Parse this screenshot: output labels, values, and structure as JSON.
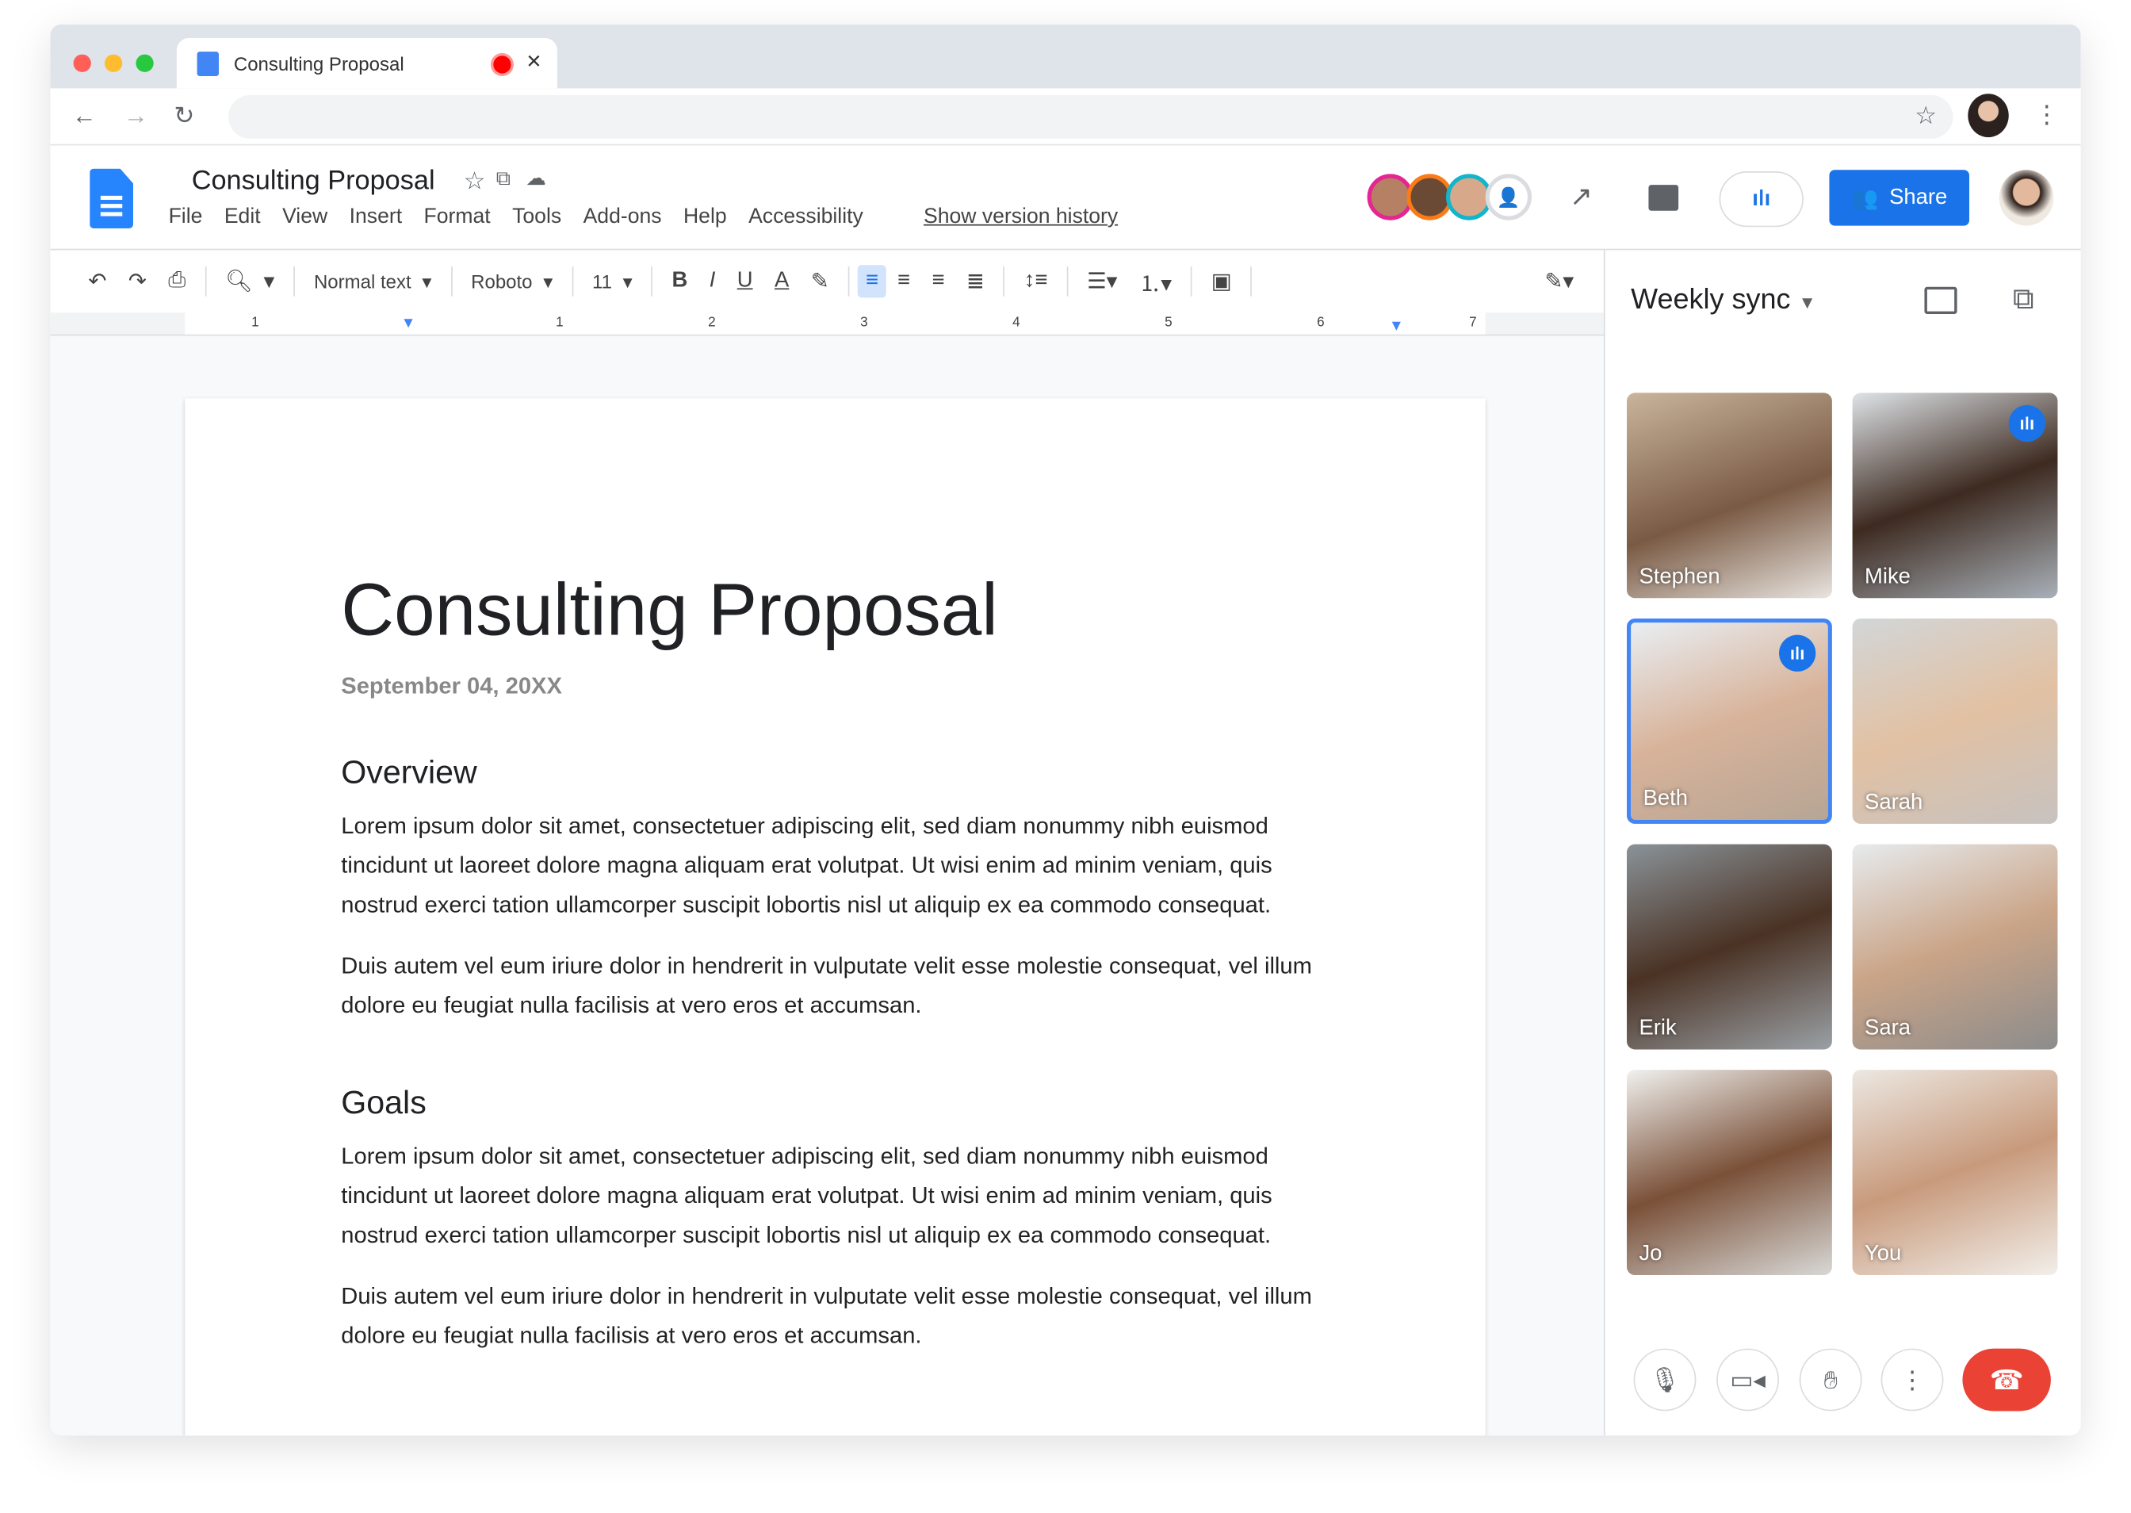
{
  "browser": {
    "tab_title": "Consulting Proposal",
    "close": "✕"
  },
  "docs": {
    "title": "Consulting Proposal",
    "menu": [
      "File",
      "Edit",
      "View",
      "Insert",
      "Format",
      "Tools",
      "Add-ons",
      "Help",
      "Accessibility"
    ],
    "version_history": "Show version history",
    "share": "Share"
  },
  "toolbar": {
    "style": "Normal text",
    "font": "Roboto",
    "size": "11"
  },
  "ruler": [
    "1",
    "1",
    "2",
    "3",
    "4",
    "5",
    "6",
    "7"
  ],
  "document": {
    "title": "Consulting Proposal",
    "date": "September 04, 20XX",
    "sections": [
      {
        "heading": "Overview",
        "paragraphs": [
          "Lorem ipsum dolor sit amet, consectetuer adipiscing elit, sed diam nonummy nibh euismod tincidunt ut laoreet dolore magna aliquam erat volutpat. Ut wisi enim ad minim veniam, quis nostrud exerci tation ullamcorper suscipit lobortis nisl ut aliquip ex ea commodo consequat.",
          "Duis autem vel eum iriure dolor in hendrerit in vulputate velit esse molestie consequat, vel illum dolore eu feugiat nulla facilisis at vero eros et accumsan."
        ]
      },
      {
        "heading": "Goals",
        "paragraphs": [
          "Lorem ipsum dolor sit amet, consectetuer adipiscing elit, sed diam nonummy nibh euismod tincidunt ut laoreet dolore magna aliquam erat volutpat. Ut wisi enim ad minim veniam, quis nostrud exerci tation ullamcorper suscipit lobortis nisl ut aliquip ex ea commodo consequat.",
          "Duis autem vel eum iriure dolor in hendrerit in vulputate velit esse molestie consequat, vel illum dolore eu feugiat nulla facilisis at vero eros et accumsan."
        ]
      }
    ]
  },
  "meet": {
    "title": "Weekly sync",
    "participants": [
      "Stephen",
      "Mike",
      "Beth",
      "Sarah",
      "Erik",
      "Sara",
      "Jo",
      "You"
    ]
  },
  "colors": {
    "accent": "#1a73e8",
    "end_call": "#ea4335",
    "tab_bar": "#dfe3ea"
  }
}
